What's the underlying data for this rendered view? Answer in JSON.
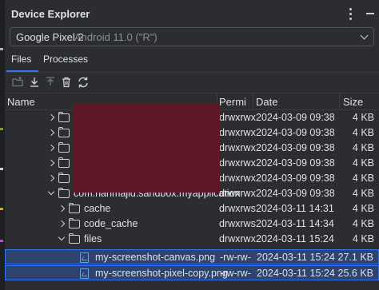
{
  "window": {
    "title": "Device Explorer"
  },
  "device": {
    "name": "Google Pixel 2",
    "os": "Android 11.0 (\"R\")"
  },
  "tabs": [
    {
      "label": "Files"
    },
    {
      "label": "Processes"
    }
  ],
  "columns": {
    "name": "Name",
    "permissions": "Permi",
    "date": "Date",
    "size": "Size"
  },
  "rows": [
    {
      "depth": 0,
      "type": "folder",
      "expanded": false,
      "name": "",
      "perm": "drwxrwx",
      "date": "2024-03-09 09:38",
      "size": "4 KB"
    },
    {
      "depth": 0,
      "type": "folder",
      "expanded": false,
      "name": "",
      "perm": "drwxrwx",
      "date": "2024-03-09 09:38",
      "size": "4 KB"
    },
    {
      "depth": 0,
      "type": "folder",
      "expanded": false,
      "name": "",
      "perm": "drwxrwx",
      "date": "2024-03-09 09:38",
      "size": "4 KB"
    },
    {
      "depth": 0,
      "type": "folder",
      "expanded": false,
      "name": "",
      "perm": "drwxrwx",
      "date": "2024-03-09 09:38",
      "size": "4 KB"
    },
    {
      "depth": 0,
      "type": "folder",
      "expanded": false,
      "name": "",
      "perm": "drwxrwx",
      "date": "2024-03-09 09:38",
      "size": "4 KB"
    },
    {
      "depth": 0,
      "type": "folder",
      "expanded": true,
      "name": "com.hanmajid.sandbox.myapplication",
      "perm": "drwxrwx",
      "date": "2024-03-09 09:38",
      "size": "4 KB"
    },
    {
      "depth": 1,
      "type": "folder",
      "expanded": false,
      "name": "cache",
      "perm": "drwxrws",
      "date": "2024-03-11 14:31",
      "size": "4 KB"
    },
    {
      "depth": 1,
      "type": "folder",
      "expanded": false,
      "name": "code_cache",
      "perm": "drwxrws",
      "date": "2024-03-11 14:34",
      "size": "4 KB"
    },
    {
      "depth": 1,
      "type": "folder",
      "expanded": true,
      "name": "files",
      "perm": "drwxrwx",
      "date": "2024-03-11 15:24",
      "size": "4 KB"
    },
    {
      "depth": 2,
      "type": "image",
      "selected": true,
      "name": "my-screenshot-canvas.png",
      "perm": "-rw-rw-",
      "date": "2024-03-11 15:24",
      "size": "27.1 KB"
    },
    {
      "depth": 2,
      "type": "image",
      "selected": true,
      "name": "my-screenshot-pixel-copy.png",
      "perm": "-rw-rw-",
      "date": "2024-03-11 15:24",
      "size": "25.6 KB"
    }
  ],
  "colors": {
    "background": "#2b2d30",
    "selection": "#2e436e",
    "accent": "#3574f0",
    "redaction": "#5c1827"
  }
}
